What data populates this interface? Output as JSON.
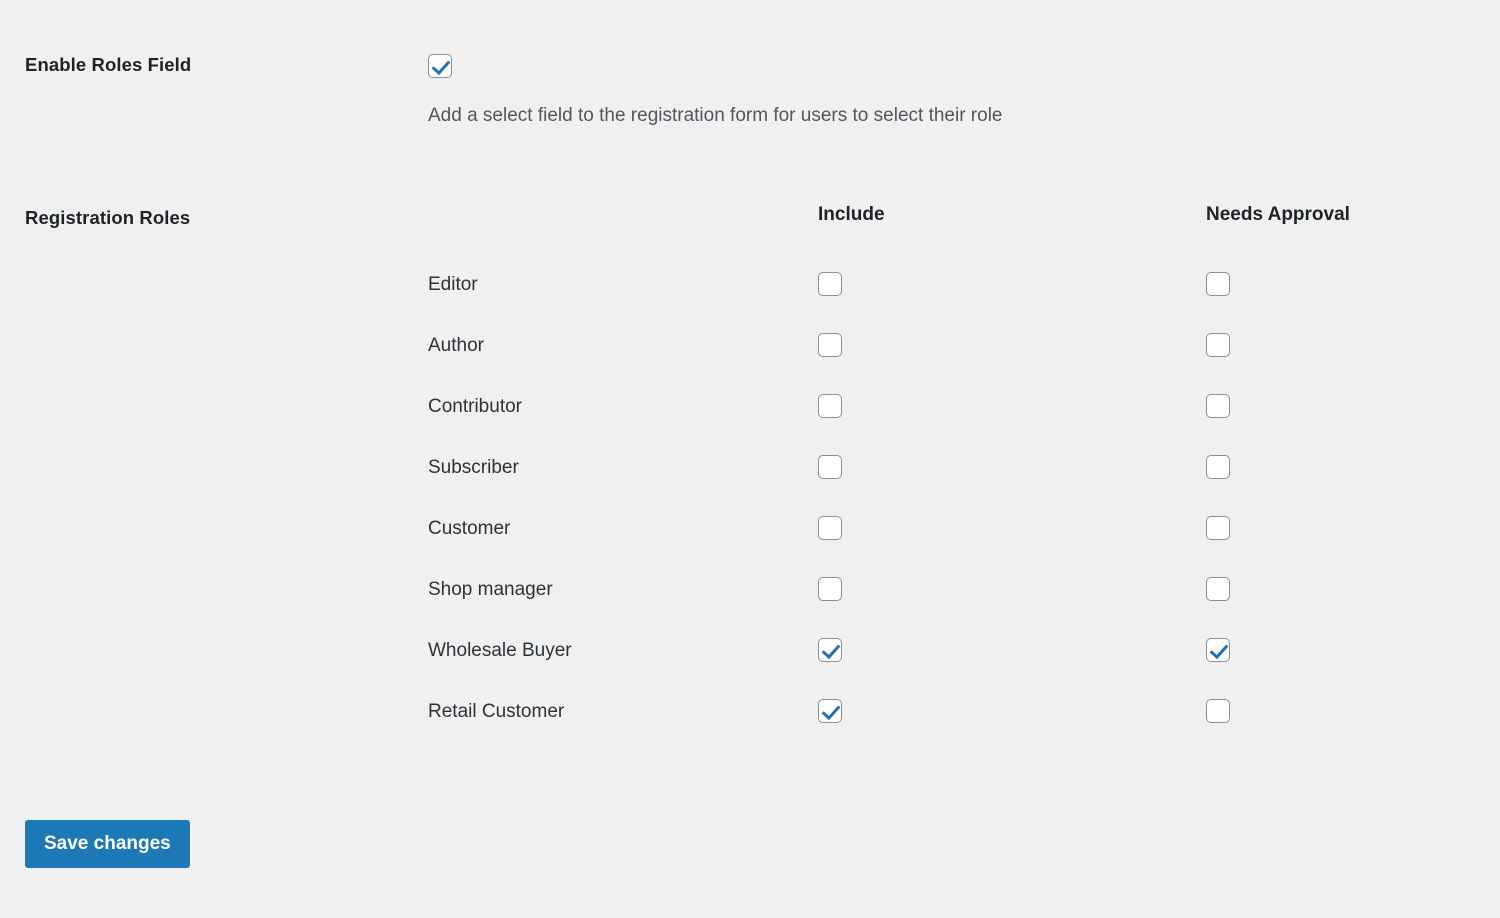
{
  "enable_roles_field": {
    "label": "Enable Roles Field",
    "checked": true,
    "description": "Add a select field to the registration form for users to select their role"
  },
  "registration_roles": {
    "label": "Registration Roles",
    "columns": {
      "include": "Include",
      "needs_approval": "Needs Approval"
    },
    "rows": [
      {
        "name": "Editor",
        "include": false,
        "needs_approval": false
      },
      {
        "name": "Author",
        "include": false,
        "needs_approval": false
      },
      {
        "name": "Contributor",
        "include": false,
        "needs_approval": false
      },
      {
        "name": "Subscriber",
        "include": false,
        "needs_approval": false
      },
      {
        "name": "Customer",
        "include": false,
        "needs_approval": false
      },
      {
        "name": "Shop manager",
        "include": false,
        "needs_approval": false
      },
      {
        "name": "Wholesale Buyer",
        "include": true,
        "needs_approval": true
      },
      {
        "name": "Retail Customer",
        "include": true,
        "needs_approval": false
      }
    ]
  },
  "actions": {
    "save_label": "Save changes"
  },
  "colors": {
    "background": "#f0f0f1",
    "accent": "#1b79b6",
    "checkmark": "#2271b1",
    "text": "#1d2327",
    "muted_text": "#50575e",
    "checkbox_border": "#8c8f94"
  }
}
